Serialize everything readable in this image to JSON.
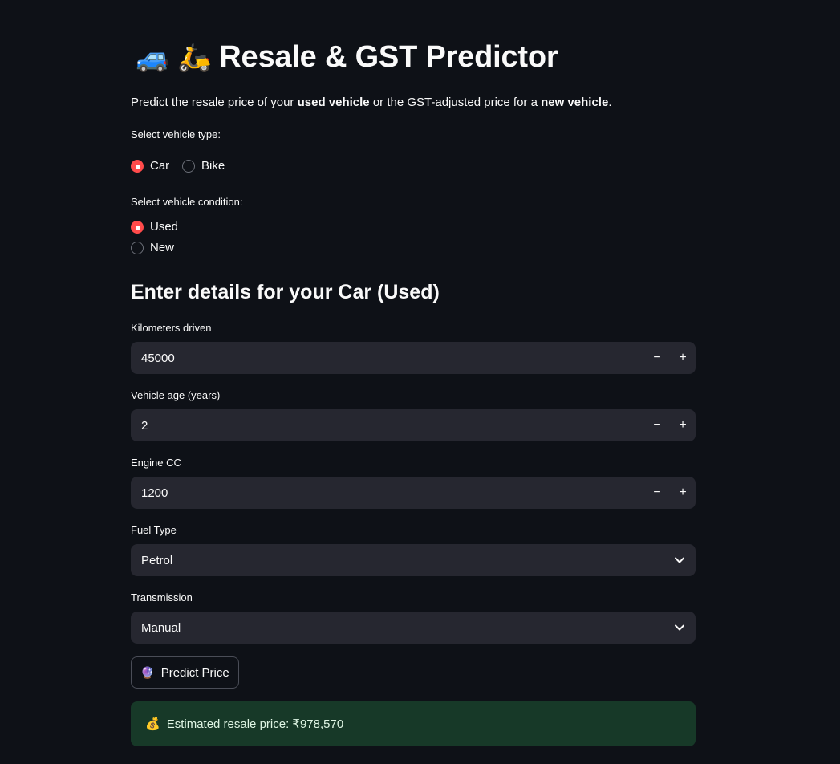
{
  "app": {
    "title": "Resale & GST Predictor",
    "title_icons": [
      "car-icon",
      "motorbike-icon"
    ],
    "subtitle": {
      "p1": "Predict the resale price of your ",
      "b1": "used vehicle",
      "p2": " or the GST-adjusted price for a ",
      "b2": "new vehicle",
      "p3": "."
    }
  },
  "vehicle_type": {
    "label": "Select vehicle type:",
    "options": [
      "Car",
      "Bike"
    ],
    "selected": "Car"
  },
  "vehicle_condition": {
    "label": "Select vehicle condition:",
    "options": [
      "Used",
      "New"
    ],
    "selected": "Used"
  },
  "form": {
    "heading": "Enter details for your Car (Used)",
    "km": {
      "label": "Kilometers driven",
      "value": "45000"
    },
    "age": {
      "label": "Vehicle age (years)",
      "value": "2"
    },
    "cc": {
      "label": "Engine CC",
      "value": "1200"
    },
    "fuel": {
      "label": "Fuel Type",
      "value": "Petrol"
    },
    "transmission": {
      "label": "Transmission",
      "value": "Manual"
    },
    "minus": "−",
    "plus": "+"
  },
  "predict_button": {
    "icon": "crystal-ball-icon",
    "label": "Predict Price"
  },
  "result": {
    "icon": "money-bag-icon",
    "text": "Estimated resale price: ₹978,570"
  },
  "colors": {
    "accent": "#ff4b4b",
    "background": "#0e1117",
    "input_bg": "#262730",
    "success_bg": "#173928"
  }
}
